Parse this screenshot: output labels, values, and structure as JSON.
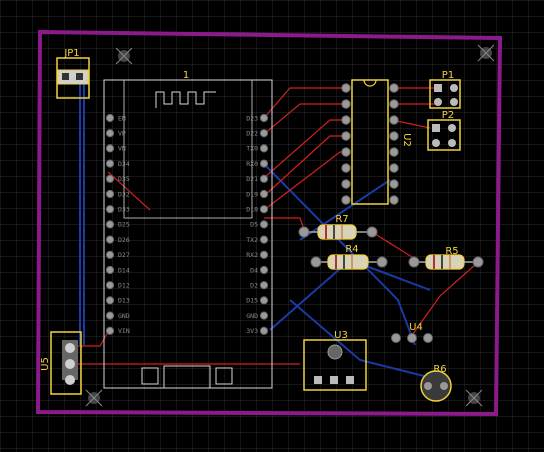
{
  "colors": {
    "board_outline": "#8b1a8b",
    "silkscreen": "#f2d23c",
    "module_outline": "#d9d9d9",
    "top_trace": "#d02020",
    "bottom_trace": "#1a3aa8",
    "pad": "#b0b0b0",
    "grid": "#3a3a3a"
  },
  "components": {
    "jp1": "JP1",
    "u1": "1",
    "p1": "P1",
    "p2": "P2",
    "u2": "U2",
    "r7": "R7",
    "r4": "R4",
    "r5": "R5",
    "u3": "U3",
    "u4": "U4",
    "u5": "U5",
    "r6": "R6"
  },
  "esp32_left_pins": [
    "EN",
    "VP",
    "VN",
    "D34",
    "D35",
    "D32",
    "D33",
    "D25",
    "D26",
    "D27",
    "D14",
    "D12",
    "D13",
    "GND",
    "VIN"
  ],
  "esp32_right_pins": [
    "D23",
    "D22",
    "TX0",
    "RX0",
    "D21",
    "D19",
    "D18",
    "D5",
    "TX2",
    "RX2",
    "D4",
    "D2",
    "D15",
    "GND",
    "3V3"
  ],
  "icons": [
    "mounting-hole-icon",
    "antenna-icon"
  ]
}
